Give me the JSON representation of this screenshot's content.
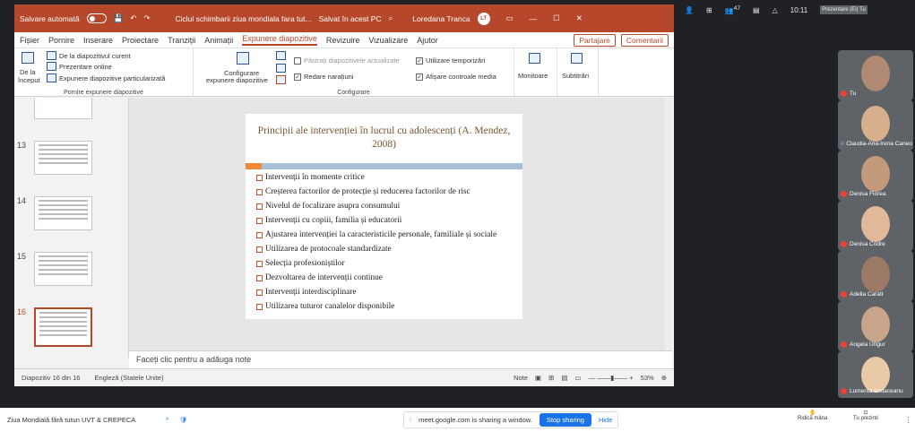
{
  "titlebar": {
    "autosave": "Salvare automată",
    "doc_title": "Ciclul schimbarii ziua mondiala fara tut...",
    "saved": "Salvat în acest PC",
    "user": "Loredana Tranca",
    "user_initials": "LT"
  },
  "menu": {
    "items": [
      "Fișier",
      "Pornire",
      "Inserare",
      "Proiectare",
      "Tranziții",
      "Animații",
      "Expunere diapozitive",
      "Revizuire",
      "Vizualizare",
      "Ajutor"
    ],
    "share": "Partajare",
    "comments": "Comentarii"
  },
  "ribbon": {
    "from_start_top": "De la",
    "from_start_bottom": "început",
    "from_current": "De la diapozitivul curent",
    "present_online": "Prezentare online",
    "custom_show": "Expunere diapozitive particularizată",
    "group1": "Pornire expunere diapozitive",
    "setup_top": "Configurare",
    "setup_bottom": "expunere diapozitive",
    "keep_updated": "Păstrați diapozitivele actualizate",
    "use_timings": "Utilizare temporizări",
    "record_narration": "Redare narațiuni",
    "show_media": "Afișare controale media",
    "group2": "Configurare",
    "monitors": "Monitoare",
    "subtitles": "Subtitrări"
  },
  "thumbnails": [
    {
      "num": "13"
    },
    {
      "num": "14"
    },
    {
      "num": "15"
    },
    {
      "num": "16"
    }
  ],
  "slide": {
    "title": "Principii ale intervenției în lucrul cu adolescenți (A. Mendez, 2008)",
    "bullets": [
      "Intervenții în momente critice",
      "Creșterea factorilor de protecție și reducerea factorilor de risc",
      "Nivelul de focalizare asupra consumului",
      "Intervenții cu copiii, familia și educatorii",
      "Ajustarea intervenției la caracteristicile personale, familiale și sociale",
      "Utilizarea de protocoale standardizate",
      "Selecția profesioniștilor",
      "Dezvoltarea de intervenții continue",
      "Intervenții interdisciplinare",
      "Utilizarea tuturor canalelor disponibile"
    ]
  },
  "notes": {
    "placeholder": "Faceți clic pentru a adăuga note"
  },
  "status": {
    "slide_count": "Diapozitiv 16 din 16",
    "language": "Engleză (Statele Unite)",
    "notes_btn": "Note",
    "zoom": "53%"
  },
  "meet": {
    "participants_count": "47",
    "time": "10:11",
    "presenting": "Prezentare (Ei) Tu",
    "tiles": [
      "Tu",
      "Claudia-Ana-Irena Caneo",
      "Denisa Florea",
      "Denisa Codre",
      "Adelia Caratt",
      "Angela Ungur",
      "Lumerita Iordaceanu"
    ]
  },
  "bottom": {
    "tab_title": "Ziua Mondială fără tutun UVT & CREPECA",
    "sharing_text": "meet.google.com is sharing a window.",
    "stop_sharing": "Stop sharing",
    "hide": "Hide",
    "raise_hand": "Ridică mâna",
    "present_now": "Tu prezinti"
  }
}
